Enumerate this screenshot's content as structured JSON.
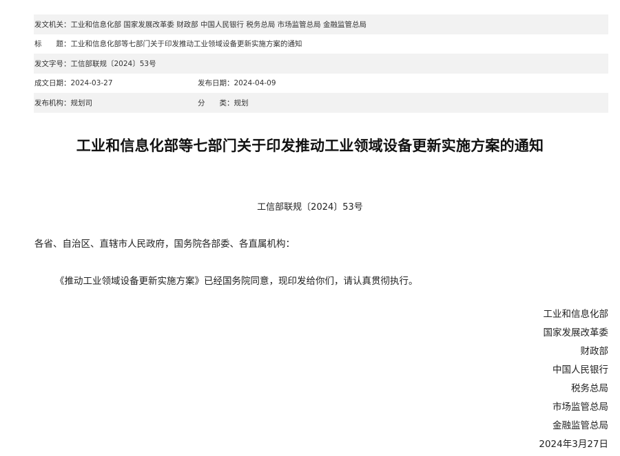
{
  "meta": {
    "issuer_label": "发文机关：",
    "issuer_value": "工业和信息化部 国家发展改革委 财政部 中国人民银行 税务总局 市场监管总局 金融监管总局",
    "title_label": "标　　题：",
    "title_value": "工业和信息化部等七部门关于印发推动工业领域设备更新实施方案的通知",
    "doc_no_label": "发文字号：",
    "doc_no_value": "工信部联规〔2024〕53号",
    "written_date_label": "成文日期：",
    "written_date_value": "2024-03-27",
    "publish_date_label": "发布日期：",
    "publish_date_value": "2024-04-09",
    "publisher_label": "发布机构：",
    "publisher_value": "规划司",
    "category_label": "分　　类：",
    "category_value": "规划"
  },
  "document": {
    "title": "工业和信息化部等七部门关于印发推动工业领域设备更新实施方案的通知",
    "number": "工信部联规〔2024〕53号",
    "recipients": "各省、自治区、直辖市人民政府，国务院各部委、各直属机构：",
    "body": "《推动工业领域设备更新实施方案》已经国务院同意，现印发给你们，请认真贯彻执行。",
    "signatories": [
      "工业和信息化部",
      "国家发展改革委",
      "财政部",
      "中国人民银行",
      "税务总局",
      "市场监管总局",
      "金融监管总局"
    ],
    "date": "2024年3月27日"
  }
}
